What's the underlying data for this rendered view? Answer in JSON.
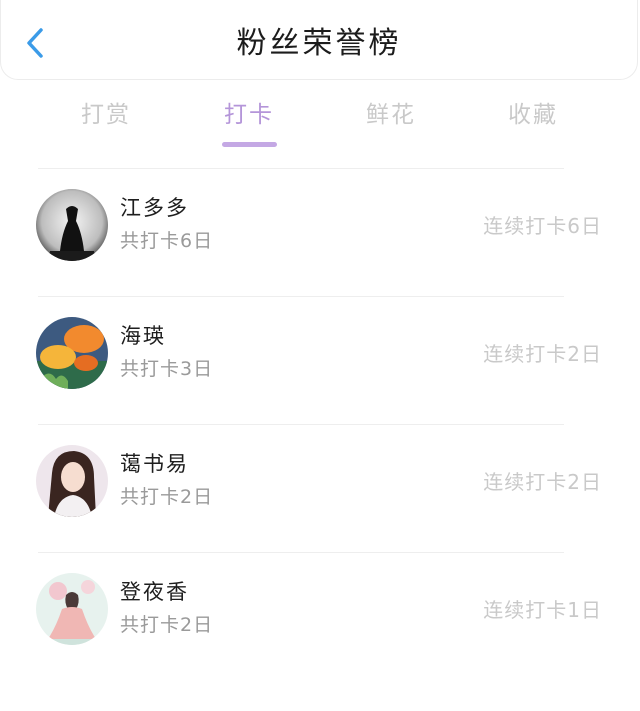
{
  "header": {
    "title": "粉丝荣誉榜",
    "back_icon": "chevron-left-icon",
    "accent": "#3b9be8"
  },
  "tabs": [
    {
      "label": "打赏",
      "active": false
    },
    {
      "label": "打卡",
      "active": true
    },
    {
      "label": "鲜花",
      "active": false
    },
    {
      "label": "收藏",
      "active": false
    }
  ],
  "colors": {
    "active_tab": "#b495d9",
    "inactive_tab": "#c9c9c9"
  },
  "fans": [
    {
      "name": "江多多",
      "total": "共打卡6日",
      "streak": "连续打卡6日"
    },
    {
      "name": "海瑛",
      "total": "共打卡3日",
      "streak": "连续打卡2日"
    },
    {
      "name": "蔼书易",
      "total": "共打卡2日",
      "streak": "连续打卡2日"
    },
    {
      "name": "登夜香",
      "total": "共打卡2日",
      "streak": "连续打卡1日"
    }
  ]
}
